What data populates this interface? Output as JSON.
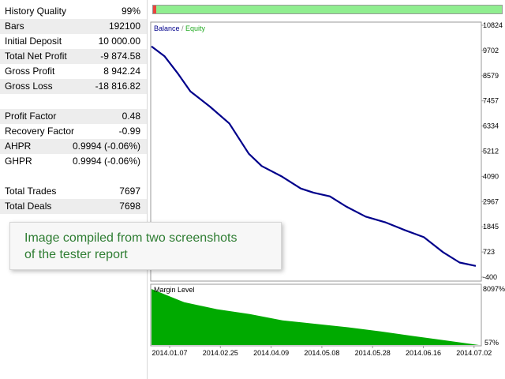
{
  "report_stats": [
    {
      "label": "History Quality",
      "value": "99%"
    },
    {
      "label": "Bars",
      "value": "192100"
    },
    {
      "label": "Initial Deposit",
      "value": "10 000.00"
    },
    {
      "label": "Total Net Profit",
      "value": "-9 874.58"
    },
    {
      "label": "Gross Profit",
      "value": "8 942.24"
    },
    {
      "label": "Gross Loss",
      "value": "-18 816.82"
    },
    {
      "label": "",
      "value": ""
    },
    {
      "label": "Profit Factor",
      "value": "0.48"
    },
    {
      "label": "Recovery Factor",
      "value": "-0.99"
    },
    {
      "label": "AHPR",
      "value": "0.9994 (-0.06%)"
    },
    {
      "label": "GHPR",
      "value": "0.9994 (-0.06%)"
    },
    {
      "label": "",
      "value": ""
    },
    {
      "label": "Total Trades",
      "value": "7697"
    },
    {
      "label": "Total Deals",
      "value": "7698"
    }
  ],
  "history_quality_percent": 99,
  "balance_chart": {
    "legend_balance": "Balance",
    "legend_sep": " / ",
    "legend_equity": "Equity",
    "y_ticks": [
      "10824",
      "9702",
      "8579",
      "7457",
      "6334",
      "5212",
      "4090",
      "2967",
      "1845",
      "723",
      "-400"
    ],
    "colors": {
      "balance": "#00008b",
      "equity": "#228b22"
    },
    "equity_curve": [
      {
        "t": 0,
        "v": 9880
      },
      {
        "t": 0.04,
        "v": 9450
      },
      {
        "t": 0.08,
        "v": 8700
      },
      {
        "t": 0.12,
        "v": 7880
      },
      {
        "t": 0.18,
        "v": 7200
      },
      {
        "t": 0.24,
        "v": 6450
      },
      {
        "t": 0.3,
        "v": 5100
      },
      {
        "t": 0.34,
        "v": 4550
      },
      {
        "t": 0.4,
        "v": 4100
      },
      {
        "t": 0.46,
        "v": 3550
      },
      {
        "t": 0.5,
        "v": 3360
      },
      {
        "t": 0.55,
        "v": 3200
      },
      {
        "t": 0.6,
        "v": 2750
      },
      {
        "t": 0.66,
        "v": 2300
      },
      {
        "t": 0.72,
        "v": 2050
      },
      {
        "t": 0.78,
        "v": 1700
      },
      {
        "t": 0.84,
        "v": 1380
      },
      {
        "t": 0.9,
        "v": 700
      },
      {
        "t": 0.95,
        "v": 250
      },
      {
        "t": 1.0,
        "v": 100
      }
    ]
  },
  "margin_chart": {
    "title": "Margin Level",
    "y_top": "8097%",
    "y_bottom": "57%",
    "color": "#00aa00",
    "x_ticks": [
      "2014.01.07",
      "2014.02.25",
      "2014.04.09",
      "2014.05.08",
      "2014.05.28",
      "2014.06.16",
      "2014.07.02"
    ],
    "level_curve": [
      {
        "t": 0,
        "v": 8097
      },
      {
        "t": 0.1,
        "v": 6200
      },
      {
        "t": 0.2,
        "v": 5200
      },
      {
        "t": 0.3,
        "v": 4500
      },
      {
        "t": 0.4,
        "v": 3600
      },
      {
        "t": 0.5,
        "v": 3100
      },
      {
        "t": 0.6,
        "v": 2600
      },
      {
        "t": 0.7,
        "v": 2000
      },
      {
        "t": 0.8,
        "v": 1350
      },
      {
        "t": 0.9,
        "v": 700
      },
      {
        "t": 1.0,
        "v": 57
      }
    ]
  },
  "overlay": {
    "line1": "Image compiled from two screenshots",
    "line2": "of the tester report"
  }
}
